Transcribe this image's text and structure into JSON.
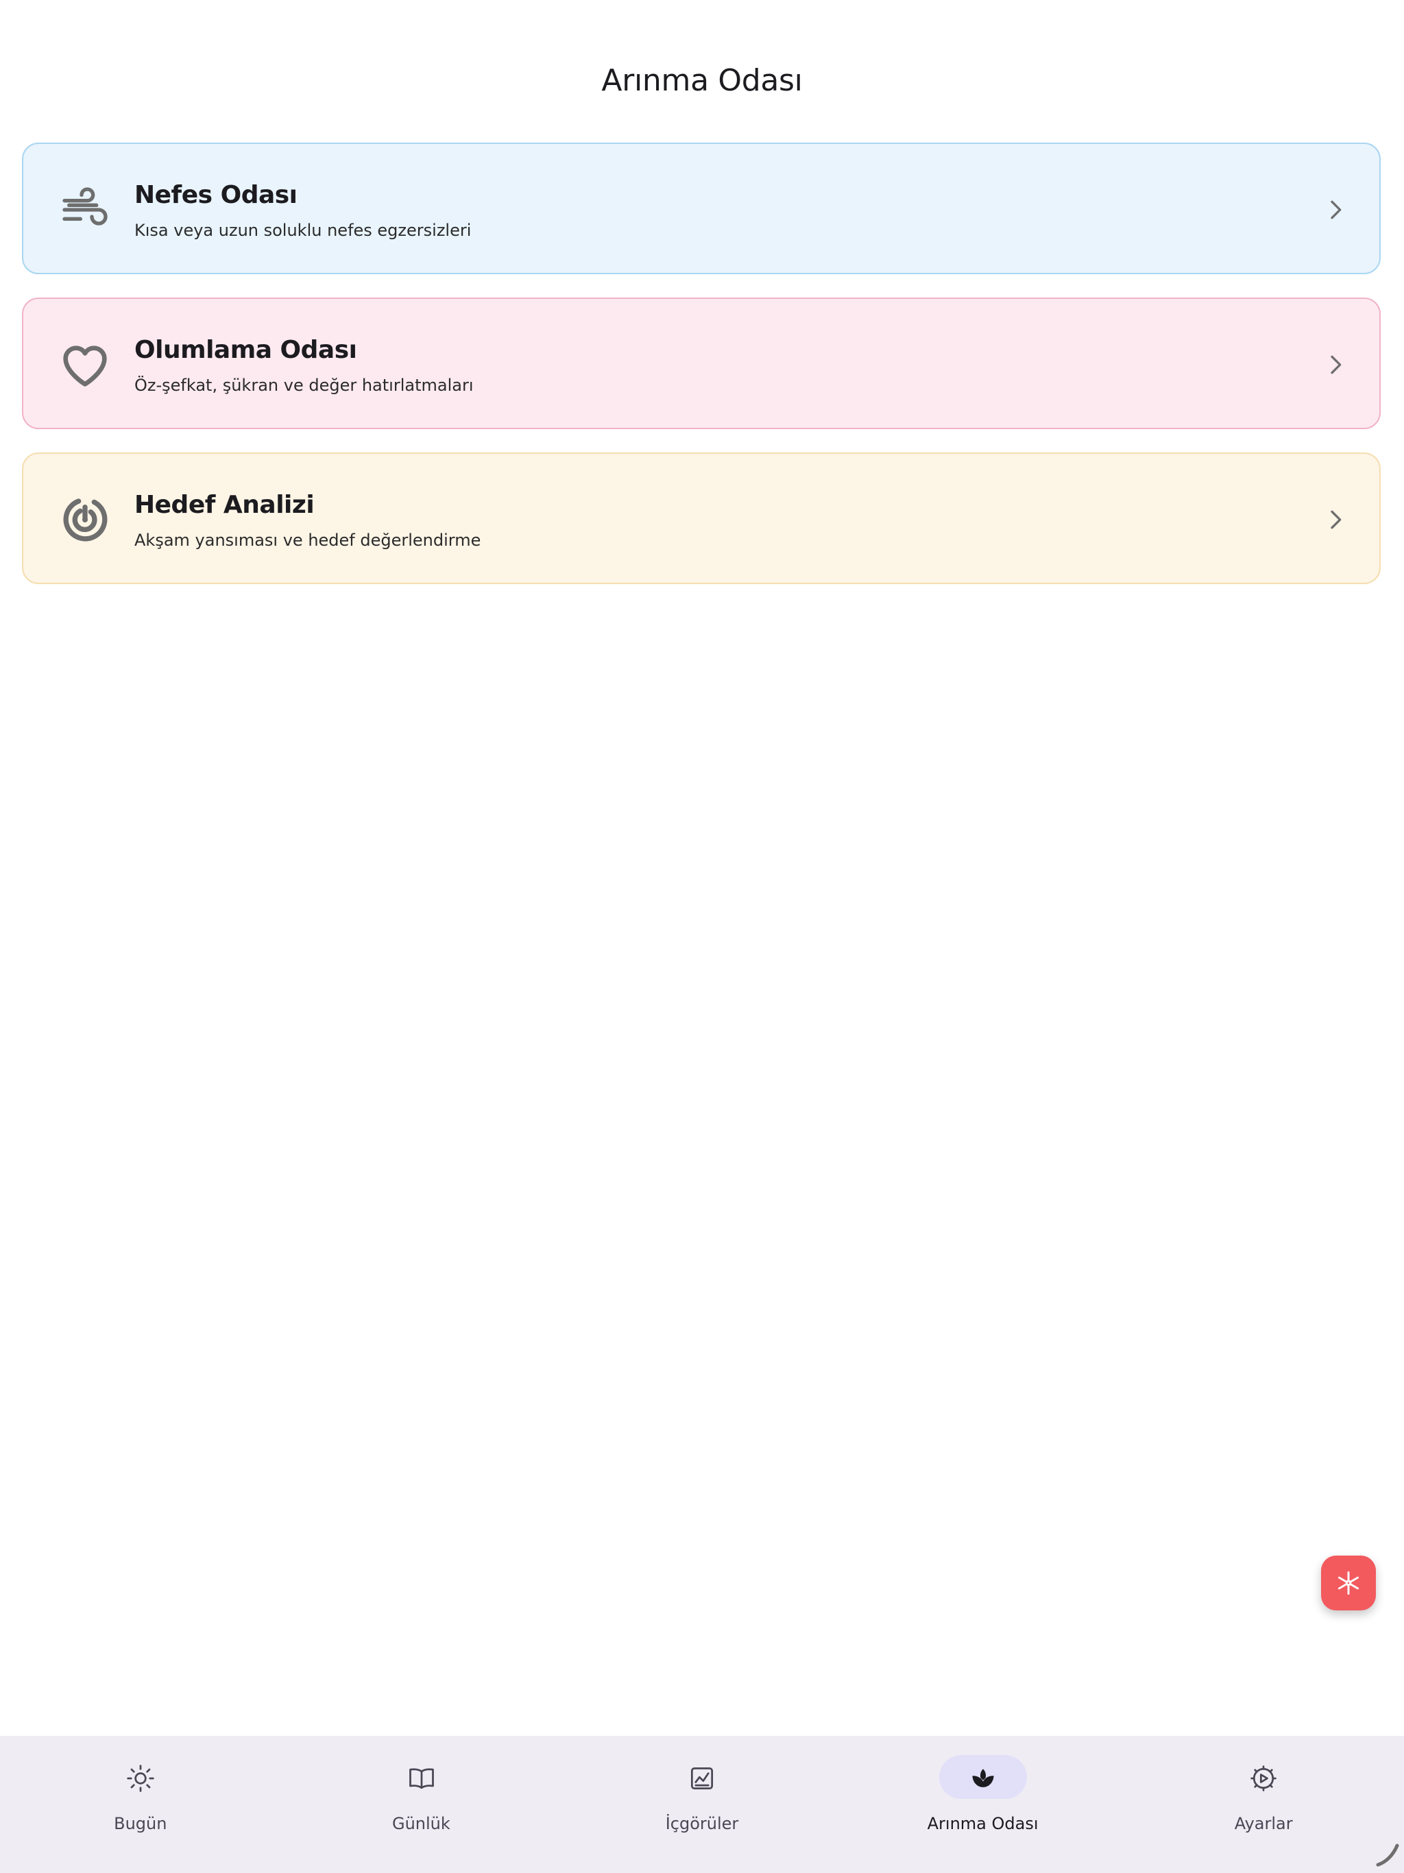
{
  "header": {
    "title": "Arınma Odası"
  },
  "cards": [
    {
      "title": "Nefes Odası",
      "subtitle": "Kısa veya uzun soluklu nefes egzersizleri",
      "icon": "wind-icon",
      "background": "#e9f4fd",
      "border": "#aad6f2"
    },
    {
      "title": "Olumlama Odası",
      "subtitle": "Öz-şefkat, şükran ve değer hatırlatmaları",
      "icon": "heart-icon",
      "background": "#fdeaf0",
      "border": "#f2b3c8"
    },
    {
      "title": "Hedef Analizi",
      "subtitle": "Akşam yansıması ve hedef değerlendirme",
      "icon": "target-icon",
      "background": "#fdf5e6",
      "border": "#f5deb0"
    }
  ],
  "fab": {
    "icon": "asterisk-icon",
    "color": "#f25a5e"
  },
  "bottom_nav": {
    "active": "Arınma Odası",
    "items": [
      {
        "label": "Bugün",
        "icon": "sun-icon"
      },
      {
        "label": "Günlük",
        "icon": "book-icon"
      },
      {
        "label": "İçgörüler",
        "icon": "chart-icon"
      },
      {
        "label": "Arınma Odası",
        "icon": "lotus-icon"
      },
      {
        "label": "Ayarlar",
        "icon": "gear-icon"
      }
    ]
  }
}
